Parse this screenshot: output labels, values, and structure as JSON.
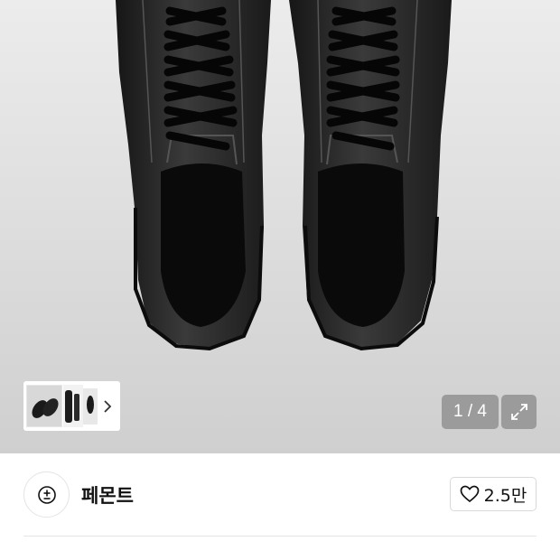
{
  "gallery": {
    "counter": "1 / 4",
    "icons": {
      "next": "chevron-right-icon",
      "expand": "expand-arrows-icon"
    }
  },
  "brand": {
    "name": "페몬트",
    "logo_icon": "plus-minus-circle-logo"
  },
  "like": {
    "count": "2.5만",
    "icon": "heart-outline-icon"
  },
  "colors": {
    "hero_bg": "#dcdcdc",
    "overlay": "#8c8c8c",
    "shoe": "#1a1a1a"
  }
}
